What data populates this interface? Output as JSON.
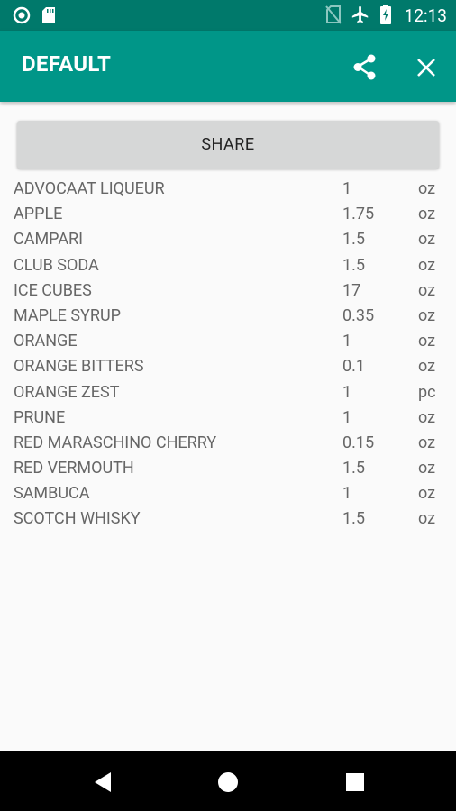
{
  "status_bar": {
    "time": "12:13",
    "icons": [
      "circle-notification-icon",
      "sd-card-icon",
      "no-sim-icon",
      "airplane-mode-icon",
      "battery-charging-icon"
    ]
  },
  "app_bar": {
    "title": "DEFAULT",
    "icons": [
      "share-icon",
      "close-icon"
    ]
  },
  "share_button": {
    "label": "SHARE"
  },
  "ingredients": [
    {
      "name": "ADVOCAAT LIQUEUR",
      "qty": "1",
      "unit": "oz"
    },
    {
      "name": "APPLE",
      "qty": "1.75",
      "unit": "oz"
    },
    {
      "name": "CAMPARI",
      "qty": "1.5",
      "unit": "oz"
    },
    {
      "name": "CLUB SODA",
      "qty": "1.5",
      "unit": "oz"
    },
    {
      "name": "ICE CUBES",
      "qty": "17",
      "unit": "oz"
    },
    {
      "name": "MAPLE SYRUP",
      "qty": "0.35",
      "unit": "oz"
    },
    {
      "name": "ORANGE",
      "qty": "1",
      "unit": "oz"
    },
    {
      "name": "ORANGE BITTERS",
      "qty": "0.1",
      "unit": "oz"
    },
    {
      "name": "ORANGE ZEST",
      "qty": "1",
      "unit": "pc"
    },
    {
      "name": "PRUNE",
      "qty": "1",
      "unit": "oz"
    },
    {
      "name": "RED MARASCHINO CHERRY",
      "qty": "0.15",
      "unit": "oz"
    },
    {
      "name": "RED VERMOUTH",
      "qty": "1.5",
      "unit": "oz"
    },
    {
      "name": "SAMBUCA",
      "qty": "1",
      "unit": "oz"
    },
    {
      "name": "SCOTCH WHISKY",
      "qty": "1.5",
      "unit": "oz"
    }
  ],
  "nav_bar": {
    "icons": [
      "back-icon",
      "home-icon",
      "recents-icon"
    ]
  },
  "colors": {
    "status_bar": "#00796b",
    "app_bar": "#009688",
    "background": "#fafafa",
    "button": "#d6d7d7",
    "text": "#666666"
  }
}
